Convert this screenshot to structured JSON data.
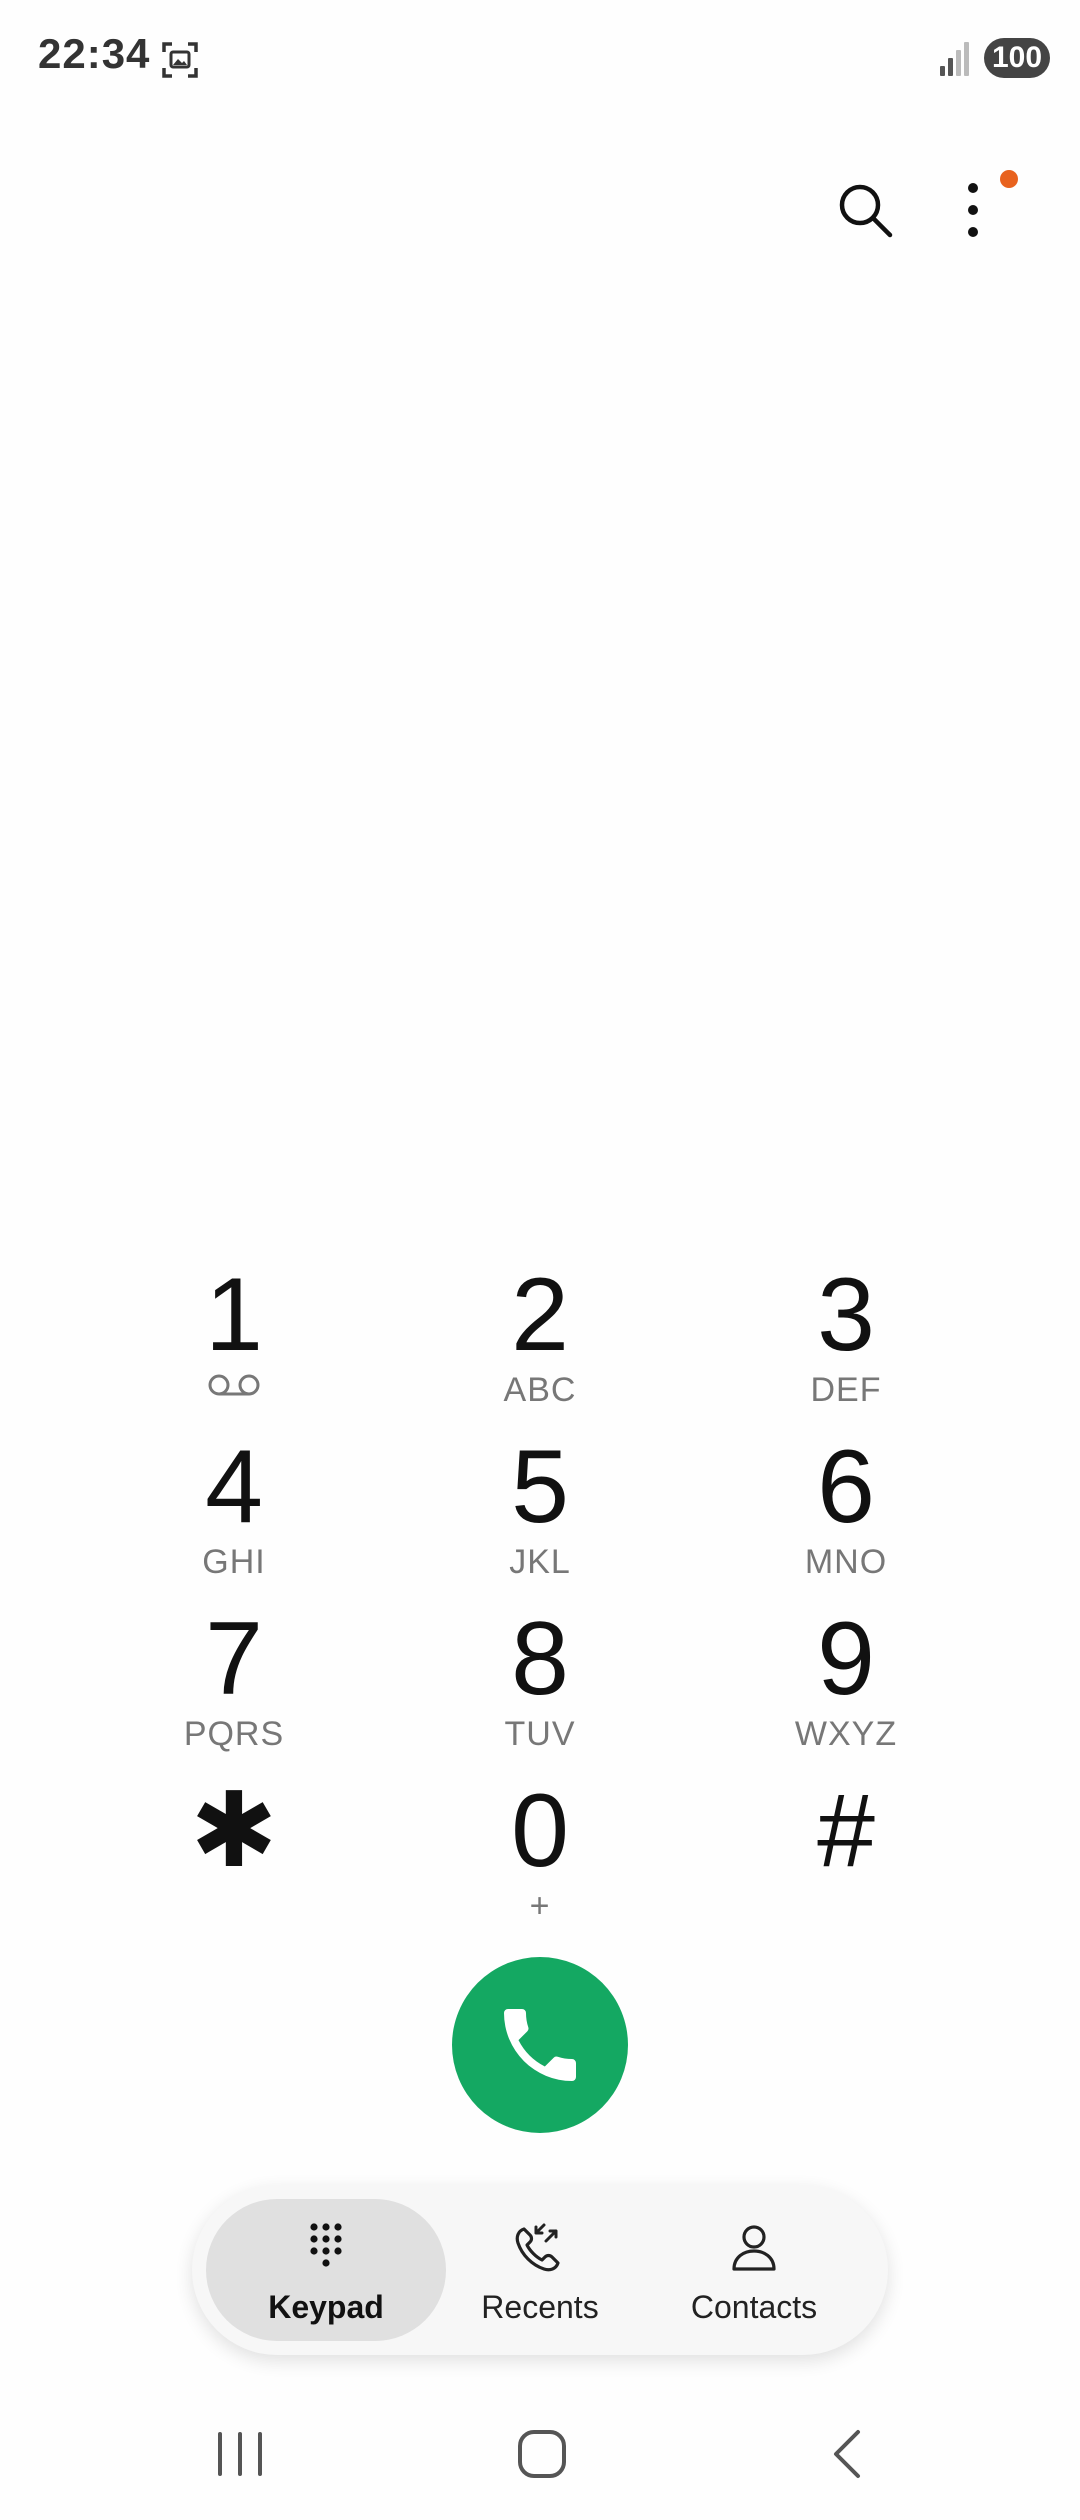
{
  "status_bar": {
    "time": "22:34",
    "battery": "100"
  },
  "keypad": {
    "keys": [
      {
        "digit": "1",
        "letters": ""
      },
      {
        "digit": "2",
        "letters": "ABC"
      },
      {
        "digit": "3",
        "letters": "DEF"
      },
      {
        "digit": "4",
        "letters": "GHI"
      },
      {
        "digit": "5",
        "letters": "JKL"
      },
      {
        "digit": "6",
        "letters": "MNO"
      },
      {
        "digit": "7",
        "letters": "PQRS"
      },
      {
        "digit": "8",
        "letters": "TUV"
      },
      {
        "digit": "9",
        "letters": "WXYZ"
      },
      {
        "digit": "✱",
        "letters": ""
      },
      {
        "digit": "0",
        "letters": "+"
      },
      {
        "digit": "#",
        "letters": ""
      }
    ]
  },
  "tabs": [
    {
      "label": "Keypad",
      "active": true
    },
    {
      "label": "Recents",
      "active": false
    },
    {
      "label": "Contacts",
      "active": false
    }
  ],
  "colors": {
    "call_green": "#14a862",
    "notification_dot": "#e8621e",
    "active_tab": "#e0e0e0"
  }
}
